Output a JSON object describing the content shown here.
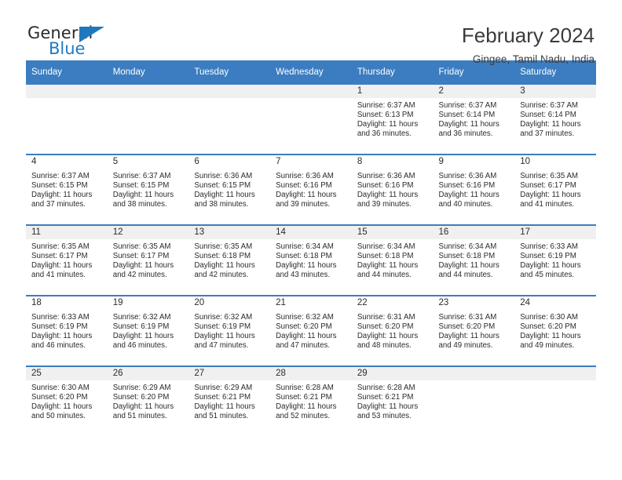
{
  "brand": {
    "word_general": "General",
    "word_blue": "Blue",
    "accent_color": "#1f78bd"
  },
  "header": {
    "title": "February 2024",
    "location": "Gingee, Tamil Nadu, India"
  },
  "calendar": {
    "header_bg": "#3b7dc0",
    "weekday_headers": [
      "Sunday",
      "Monday",
      "Tuesday",
      "Wednesday",
      "Thursday",
      "Friday",
      "Saturday"
    ],
    "weeks": [
      [
        {
          "day": "",
          "sunrise": "",
          "sunset": "",
          "daylight1": "",
          "daylight2": "",
          "empty": true
        },
        {
          "day": "",
          "sunrise": "",
          "sunset": "",
          "daylight1": "",
          "daylight2": "",
          "empty": true
        },
        {
          "day": "",
          "sunrise": "",
          "sunset": "",
          "daylight1": "",
          "daylight2": "",
          "empty": true
        },
        {
          "day": "",
          "sunrise": "",
          "sunset": "",
          "daylight1": "",
          "daylight2": "",
          "empty": true
        },
        {
          "day": "1",
          "sunrise": "Sunrise: 6:37 AM",
          "sunset": "Sunset: 6:13 PM",
          "daylight1": "Daylight: 11 hours",
          "daylight2": "and 36 minutes.",
          "empty": false
        },
        {
          "day": "2",
          "sunrise": "Sunrise: 6:37 AM",
          "sunset": "Sunset: 6:14 PM",
          "daylight1": "Daylight: 11 hours",
          "daylight2": "and 36 minutes.",
          "empty": false
        },
        {
          "day": "3",
          "sunrise": "Sunrise: 6:37 AM",
          "sunset": "Sunset: 6:14 PM",
          "daylight1": "Daylight: 11 hours",
          "daylight2": "and 37 minutes.",
          "empty": false
        }
      ],
      [
        {
          "day": "4",
          "sunrise": "Sunrise: 6:37 AM",
          "sunset": "Sunset: 6:15 PM",
          "daylight1": "Daylight: 11 hours",
          "daylight2": "and 37 minutes.",
          "empty": false
        },
        {
          "day": "5",
          "sunrise": "Sunrise: 6:37 AM",
          "sunset": "Sunset: 6:15 PM",
          "daylight1": "Daylight: 11 hours",
          "daylight2": "and 38 minutes.",
          "empty": false
        },
        {
          "day": "6",
          "sunrise": "Sunrise: 6:36 AM",
          "sunset": "Sunset: 6:15 PM",
          "daylight1": "Daylight: 11 hours",
          "daylight2": "and 38 minutes.",
          "empty": false
        },
        {
          "day": "7",
          "sunrise": "Sunrise: 6:36 AM",
          "sunset": "Sunset: 6:16 PM",
          "daylight1": "Daylight: 11 hours",
          "daylight2": "and 39 minutes.",
          "empty": false
        },
        {
          "day": "8",
          "sunrise": "Sunrise: 6:36 AM",
          "sunset": "Sunset: 6:16 PM",
          "daylight1": "Daylight: 11 hours",
          "daylight2": "and 39 minutes.",
          "empty": false
        },
        {
          "day": "9",
          "sunrise": "Sunrise: 6:36 AM",
          "sunset": "Sunset: 6:16 PM",
          "daylight1": "Daylight: 11 hours",
          "daylight2": "and 40 minutes.",
          "empty": false
        },
        {
          "day": "10",
          "sunrise": "Sunrise: 6:35 AM",
          "sunset": "Sunset: 6:17 PM",
          "daylight1": "Daylight: 11 hours",
          "daylight2": "and 41 minutes.",
          "empty": false
        }
      ],
      [
        {
          "day": "11",
          "sunrise": "Sunrise: 6:35 AM",
          "sunset": "Sunset: 6:17 PM",
          "daylight1": "Daylight: 11 hours",
          "daylight2": "and 41 minutes.",
          "empty": false
        },
        {
          "day": "12",
          "sunrise": "Sunrise: 6:35 AM",
          "sunset": "Sunset: 6:17 PM",
          "daylight1": "Daylight: 11 hours",
          "daylight2": "and 42 minutes.",
          "empty": false
        },
        {
          "day": "13",
          "sunrise": "Sunrise: 6:35 AM",
          "sunset": "Sunset: 6:18 PM",
          "daylight1": "Daylight: 11 hours",
          "daylight2": "and 42 minutes.",
          "empty": false
        },
        {
          "day": "14",
          "sunrise": "Sunrise: 6:34 AM",
          "sunset": "Sunset: 6:18 PM",
          "daylight1": "Daylight: 11 hours",
          "daylight2": "and 43 minutes.",
          "empty": false
        },
        {
          "day": "15",
          "sunrise": "Sunrise: 6:34 AM",
          "sunset": "Sunset: 6:18 PM",
          "daylight1": "Daylight: 11 hours",
          "daylight2": "and 44 minutes.",
          "empty": false
        },
        {
          "day": "16",
          "sunrise": "Sunrise: 6:34 AM",
          "sunset": "Sunset: 6:18 PM",
          "daylight1": "Daylight: 11 hours",
          "daylight2": "and 44 minutes.",
          "empty": false
        },
        {
          "day": "17",
          "sunrise": "Sunrise: 6:33 AM",
          "sunset": "Sunset: 6:19 PM",
          "daylight1": "Daylight: 11 hours",
          "daylight2": "and 45 minutes.",
          "empty": false
        }
      ],
      [
        {
          "day": "18",
          "sunrise": "Sunrise: 6:33 AM",
          "sunset": "Sunset: 6:19 PM",
          "daylight1": "Daylight: 11 hours",
          "daylight2": "and 46 minutes.",
          "empty": false
        },
        {
          "day": "19",
          "sunrise": "Sunrise: 6:32 AM",
          "sunset": "Sunset: 6:19 PM",
          "daylight1": "Daylight: 11 hours",
          "daylight2": "and 46 minutes.",
          "empty": false
        },
        {
          "day": "20",
          "sunrise": "Sunrise: 6:32 AM",
          "sunset": "Sunset: 6:19 PM",
          "daylight1": "Daylight: 11 hours",
          "daylight2": "and 47 minutes.",
          "empty": false
        },
        {
          "day": "21",
          "sunrise": "Sunrise: 6:32 AM",
          "sunset": "Sunset: 6:20 PM",
          "daylight1": "Daylight: 11 hours",
          "daylight2": "and 47 minutes.",
          "empty": false
        },
        {
          "day": "22",
          "sunrise": "Sunrise: 6:31 AM",
          "sunset": "Sunset: 6:20 PM",
          "daylight1": "Daylight: 11 hours",
          "daylight2": "and 48 minutes.",
          "empty": false
        },
        {
          "day": "23",
          "sunrise": "Sunrise: 6:31 AM",
          "sunset": "Sunset: 6:20 PM",
          "daylight1": "Daylight: 11 hours",
          "daylight2": "and 49 minutes.",
          "empty": false
        },
        {
          "day": "24",
          "sunrise": "Sunrise: 6:30 AM",
          "sunset": "Sunset: 6:20 PM",
          "daylight1": "Daylight: 11 hours",
          "daylight2": "and 49 minutes.",
          "empty": false
        }
      ],
      [
        {
          "day": "25",
          "sunrise": "Sunrise: 6:30 AM",
          "sunset": "Sunset: 6:20 PM",
          "daylight1": "Daylight: 11 hours",
          "daylight2": "and 50 minutes.",
          "empty": false
        },
        {
          "day": "26",
          "sunrise": "Sunrise: 6:29 AM",
          "sunset": "Sunset: 6:20 PM",
          "daylight1": "Daylight: 11 hours",
          "daylight2": "and 51 minutes.",
          "empty": false
        },
        {
          "day": "27",
          "sunrise": "Sunrise: 6:29 AM",
          "sunset": "Sunset: 6:21 PM",
          "daylight1": "Daylight: 11 hours",
          "daylight2": "and 51 minutes.",
          "empty": false
        },
        {
          "day": "28",
          "sunrise": "Sunrise: 6:28 AM",
          "sunset": "Sunset: 6:21 PM",
          "daylight1": "Daylight: 11 hours",
          "daylight2": "and 52 minutes.",
          "empty": false
        },
        {
          "day": "29",
          "sunrise": "Sunrise: 6:28 AM",
          "sunset": "Sunset: 6:21 PM",
          "daylight1": "Daylight: 11 hours",
          "daylight2": "and 53 minutes.",
          "empty": false
        },
        {
          "day": "",
          "sunrise": "",
          "sunset": "",
          "daylight1": "",
          "daylight2": "",
          "empty": true
        },
        {
          "day": "",
          "sunrise": "",
          "sunset": "",
          "daylight1": "",
          "daylight2": "",
          "empty": true
        }
      ]
    ]
  }
}
